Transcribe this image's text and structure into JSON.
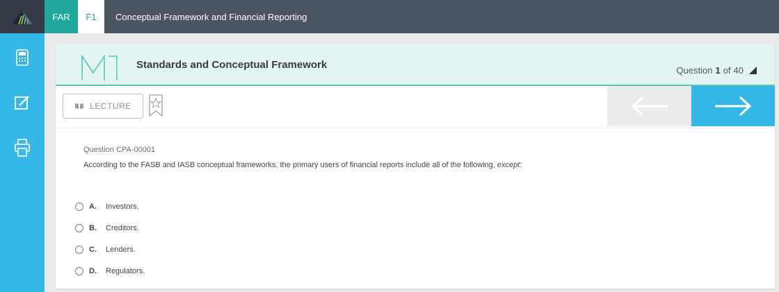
{
  "topbar": {
    "section": "FAR",
    "unit": "F1",
    "title": "Conceptual Framework and Financial Reporting"
  },
  "sidebar": {
    "items": [
      {
        "icon": "calculator-icon"
      },
      {
        "icon": "notes-edit-icon"
      },
      {
        "icon": "printer-icon"
      }
    ]
  },
  "module": {
    "code_mark": "M1",
    "title": "Standards and Conceptual Framework"
  },
  "counter": {
    "prefix": "Question",
    "current": "1",
    "separator": "of",
    "total": "40"
  },
  "toolbar": {
    "lecture_label": "LECTURE"
  },
  "question": {
    "id": "Question CPA-00001",
    "text": "According to the FASB and IASB conceptual frameworks, the primary users of financial reports include all of the following, ",
    "emphasis": "except",
    "suffix": ":"
  },
  "answers": [
    {
      "letter": "A.",
      "text": "Investors."
    },
    {
      "letter": "B.",
      "text": "Creditors."
    },
    {
      "letter": "C.",
      "text": "Lenders."
    },
    {
      "letter": "D.",
      "text": "Regulators."
    }
  ],
  "colors": {
    "topbar": "#4b5561",
    "accent_teal": "#1fa89c",
    "sidebar_blue": "#35b8e8",
    "header_bg": "#e3f5f2"
  }
}
